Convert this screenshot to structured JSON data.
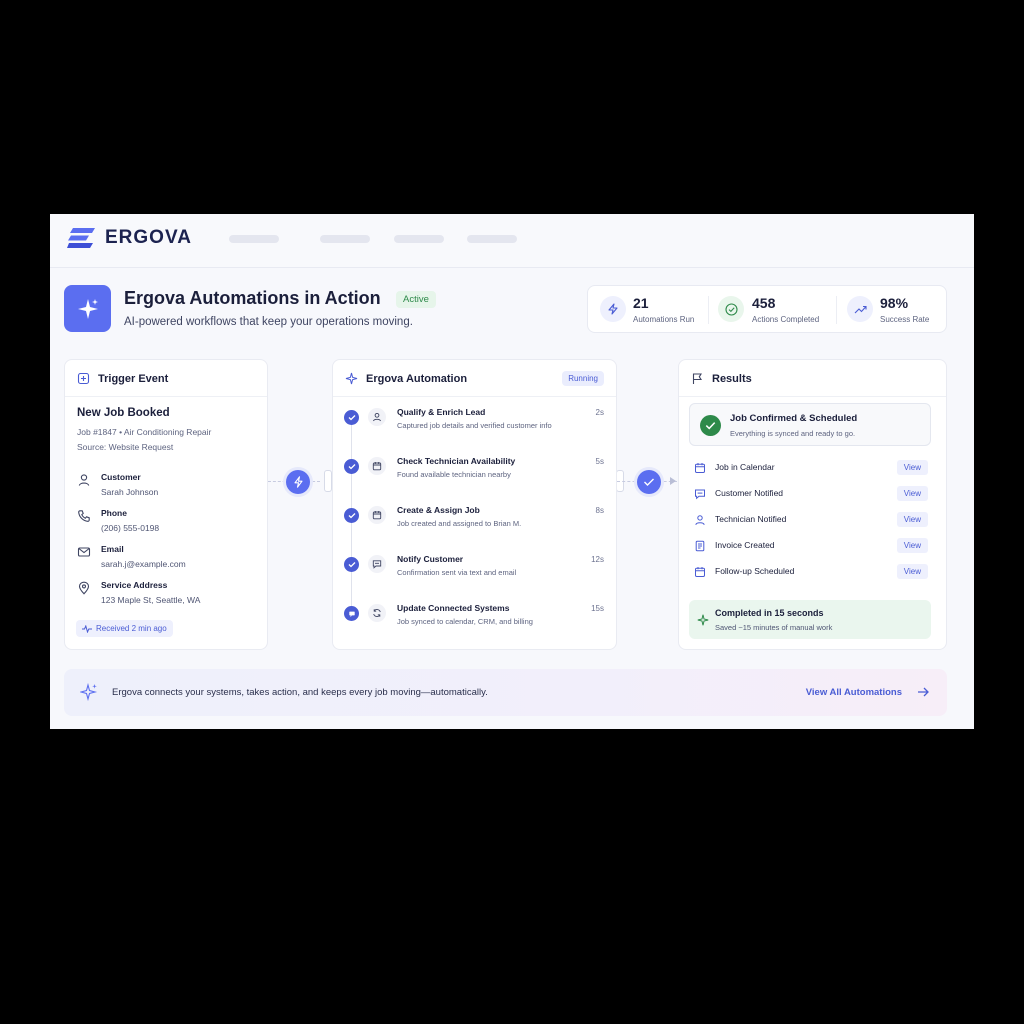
{
  "brand": {
    "name": "ERGOVA"
  },
  "header": {
    "title": "Ergova Automations in Action",
    "status": "Active",
    "subtitle": "AI-powered workflows that keep your operations moving."
  },
  "stats": [
    {
      "value": "21",
      "label": "Automations Run",
      "icon": "bolt-icon"
    },
    {
      "value": "458",
      "label": "Actions Completed",
      "icon": "check-circle-icon"
    },
    {
      "value": "98%",
      "label": "Success Rate",
      "icon": "trend-up-icon"
    }
  ],
  "trigger": {
    "title": "Trigger Event",
    "event": "New Job Booked",
    "job_line": "Job #1847  •  Air Conditioning Repair",
    "source_line": "Source: Website Request",
    "fields": [
      {
        "label": "Customer",
        "value": "Sarah Johnson",
        "icon": "user-icon"
      },
      {
        "label": "Phone",
        "value": "(206) 555-0198",
        "icon": "phone-icon"
      },
      {
        "label": "Email",
        "value": "sarah.j@example.com",
        "icon": "mail-icon"
      },
      {
        "label": "Service Address",
        "value": "123 Maple St, Seattle, WA",
        "icon": "location-pin-icon"
      }
    ],
    "received": "Received 2 min ago"
  },
  "automation": {
    "title": "Ergova Automation",
    "status": "Running",
    "steps": [
      {
        "title": "Qualify & Enrich Lead",
        "desc": "Captured job details and verified customer info",
        "time": "2s",
        "icon": "user-icon",
        "state": "done"
      },
      {
        "title": "Check Technician Availability",
        "desc": "Found available technician nearby",
        "time": "5s",
        "icon": "calendar-icon",
        "state": "done"
      },
      {
        "title": "Create & Assign Job",
        "desc": "Job created and assigned to Brian M.",
        "time": "8s",
        "icon": "calendar-icon",
        "state": "done"
      },
      {
        "title": "Notify Customer",
        "desc": "Confirmation sent via text and email",
        "time": "12s",
        "icon": "message-icon",
        "state": "done"
      },
      {
        "title": "Update Connected Systems",
        "desc": "Job synced to calendar, CRM, and billing",
        "time": "15s",
        "icon": "sync-icon",
        "state": "in-progress"
      }
    ]
  },
  "results": {
    "title": "Results",
    "confirm_title": "Job Confirmed & Scheduled",
    "confirm_sub": "Everything is synced and ready to go.",
    "items": [
      {
        "label": "Job in Calendar",
        "action": "View",
        "icon": "calendar-icon"
      },
      {
        "label": "Customer Notified",
        "action": "View",
        "icon": "message-icon"
      },
      {
        "label": "Technician Notified",
        "action": "View",
        "icon": "user-icon"
      },
      {
        "label": "Invoice Created",
        "action": "View",
        "icon": "document-icon"
      },
      {
        "label": "Follow-up Scheduled",
        "action": "View",
        "icon": "calendar-icon"
      }
    ],
    "done_title": "Completed in 15 seconds",
    "done_sub": "Saved ~15 minutes of manual work"
  },
  "footer": {
    "text": "Ergova connects your systems, takes action, and keeps every job moving—automatically.",
    "link": "View All Automations"
  },
  "colors": {
    "accent": "#5b6ef0",
    "success": "#2e8a4a",
    "text": "#1b1f3b"
  }
}
